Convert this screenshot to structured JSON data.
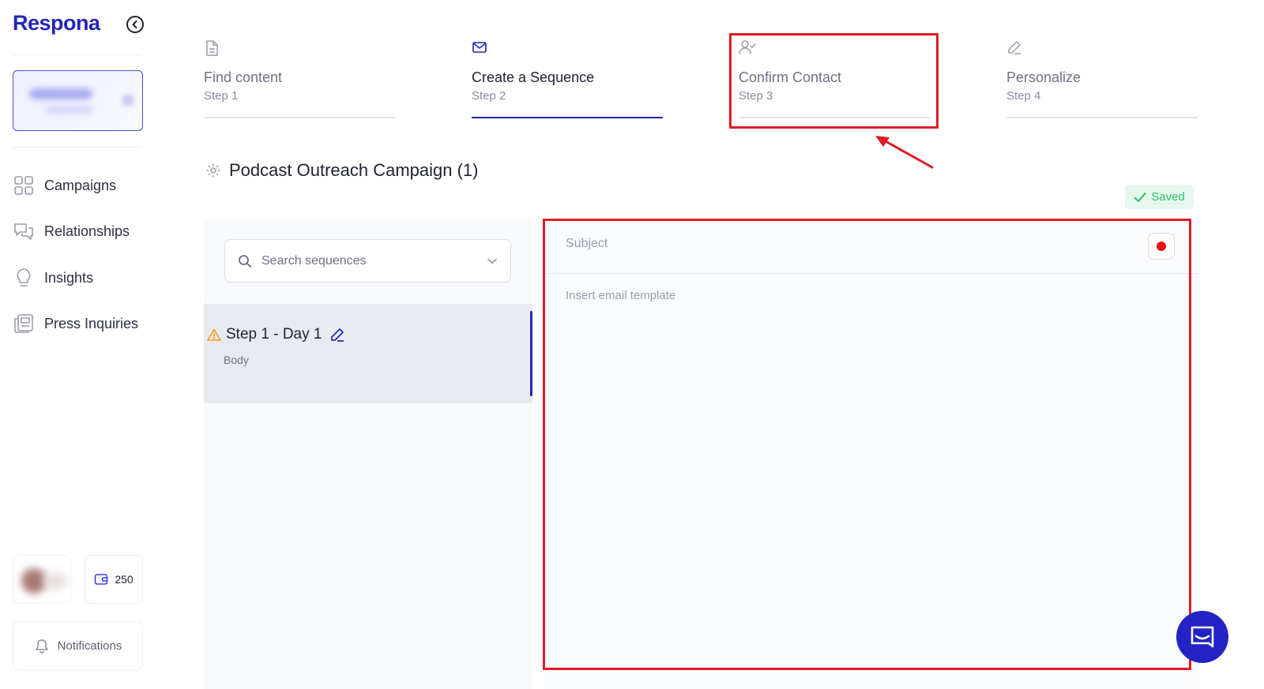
{
  "app": {
    "logo": "Respona"
  },
  "sidebar": {
    "nav": [
      {
        "label": "Campaigns",
        "icon": "grid-icon"
      },
      {
        "label": "Relationships",
        "icon": "chat-bubbles-icon"
      },
      {
        "label": "Insights",
        "icon": "lightbulb-icon"
      },
      {
        "label": "Press Inquiries",
        "icon": "newspaper-icon"
      }
    ],
    "credits": "250",
    "notifications_label": "Notifications"
  },
  "stepper": [
    {
      "title": "Find content",
      "sub": "Step 1",
      "icon": "document-icon"
    },
    {
      "title": "Create a Sequence",
      "sub": "Step 2",
      "icon": "envelope-icon"
    },
    {
      "title": "Confirm Contact",
      "sub": "Step 3",
      "icon": "user-check-icon"
    },
    {
      "title": "Personalize",
      "sub": "Step 4",
      "icon": "pen-icon"
    }
  ],
  "campaign": {
    "title": "Podcast Outreach Campaign (1)",
    "saved_label": "Saved"
  },
  "sequences": {
    "search_placeholder": "Search sequences",
    "items": [
      {
        "title": "Step 1 - Day 1",
        "sub": "Body"
      }
    ]
  },
  "editor": {
    "subject_placeholder": "Subject",
    "body_placeholder": "Insert email template"
  },
  "colors": {
    "accent": "#2525b8",
    "annotation": "#e01b24",
    "saved": "#2cc26a"
  }
}
